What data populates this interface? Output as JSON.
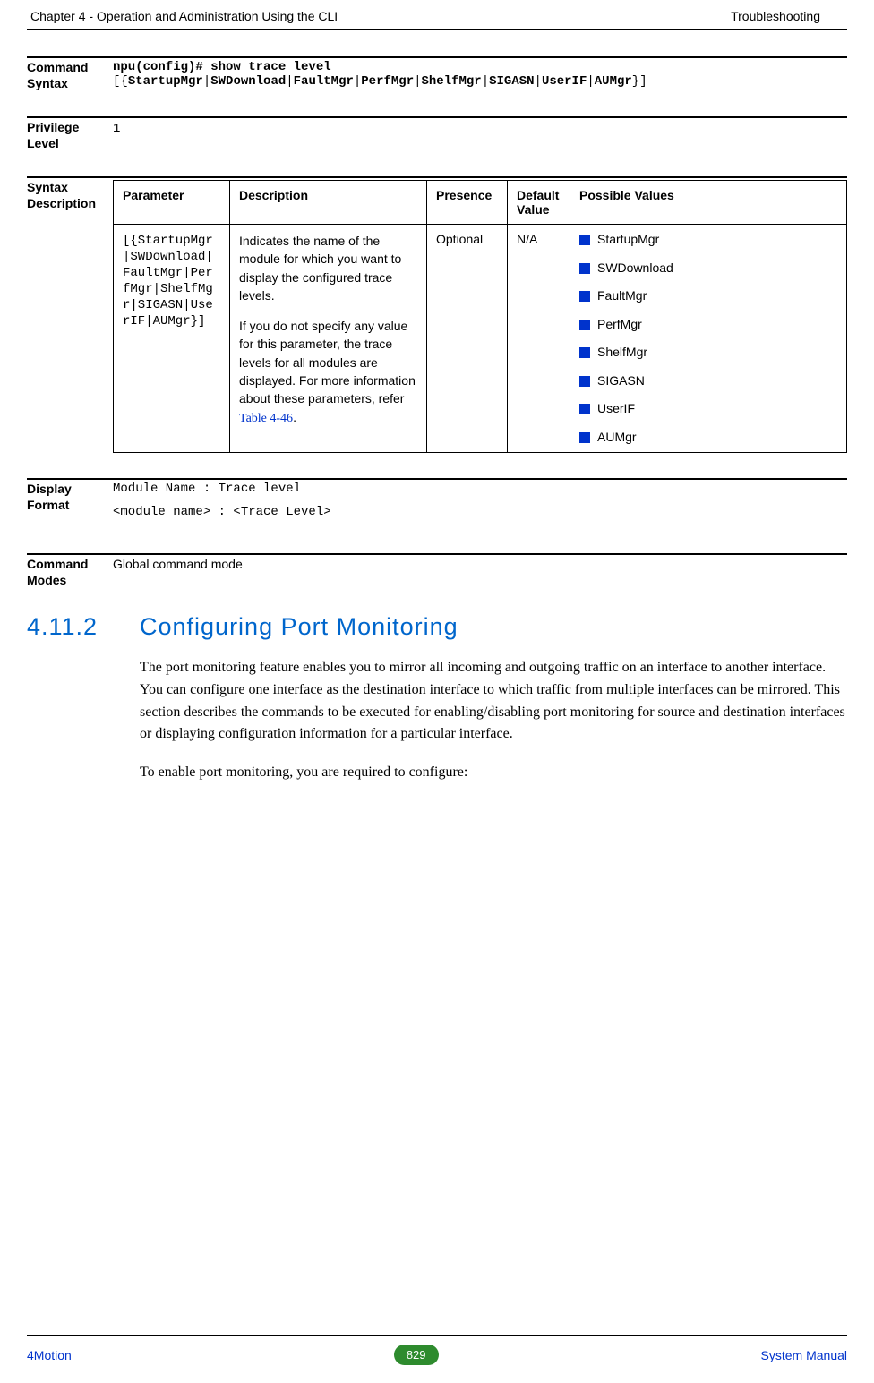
{
  "header": {
    "left": "Chapter 4 - Operation and Administration Using the CLI",
    "right": "Troubleshooting"
  },
  "sections": {
    "command_syntax": {
      "label": "Command Syntax",
      "line1": "npu(config)# show trace level",
      "line2_open": "[{",
      "line2_parts": [
        "StartupMgr",
        "SWDownload",
        "FaultMgr",
        "PerfMgr",
        "ShelfMgr",
        "SIGASN",
        "UserIF",
        "AUMgr"
      ],
      "line2_close": "}]"
    },
    "privilege": {
      "label": "Privilege Level",
      "value": "1"
    },
    "syntax_desc": {
      "label": "Syntax Description",
      "headers": [
        "Parameter",
        "Description",
        "Presence",
        "Default Value",
        "Possible Values"
      ],
      "row": {
        "parameter": "[{StartupMgr|SWDownload|FaultMgr|PerfMgr|ShelfMgr|SIGASN|UserIF|AUMgr}]",
        "desc_p1": "Indicates the name of the module for which you want to display the configured trace levels.",
        "desc_p2": "If you do not specify any value for this parameter, the trace levels for all modules are displayed. For more information about these parameters, refer ",
        "desc_link": "Table 4-46",
        "desc_after": ".",
        "presence": "Optional",
        "default": "N/A",
        "values": [
          "StartupMgr",
          "SWDownload",
          "FaultMgr",
          "PerfMgr",
          "ShelfMgr",
          "SIGASN",
          "UserIF",
          "AUMgr"
        ]
      }
    },
    "display_format": {
      "label": "Display Format",
      "line1": "Module Name     :   Trace level",
      "line2": "<module name>    :   <Trace Level>"
    },
    "command_modes": {
      "label": "Command Modes",
      "value": "Global command mode"
    }
  },
  "heading": {
    "num": "4.11.2",
    "title": "Configuring Port Monitoring"
  },
  "body": {
    "p1": "The port monitoring feature enables you to mirror all incoming and outgoing traffic on an interface to another interface. You can configure one interface as the destination interface to which traffic from multiple interfaces can be mirrored. This section describes the commands to be executed for enabling/disabling port monitoring for source and destination interfaces or displaying configuration information for a particular interface.",
    "p2": "To enable port monitoring, you are required to configure:"
  },
  "footer": {
    "left": "4Motion",
    "page": "829",
    "right": "System Manual"
  }
}
